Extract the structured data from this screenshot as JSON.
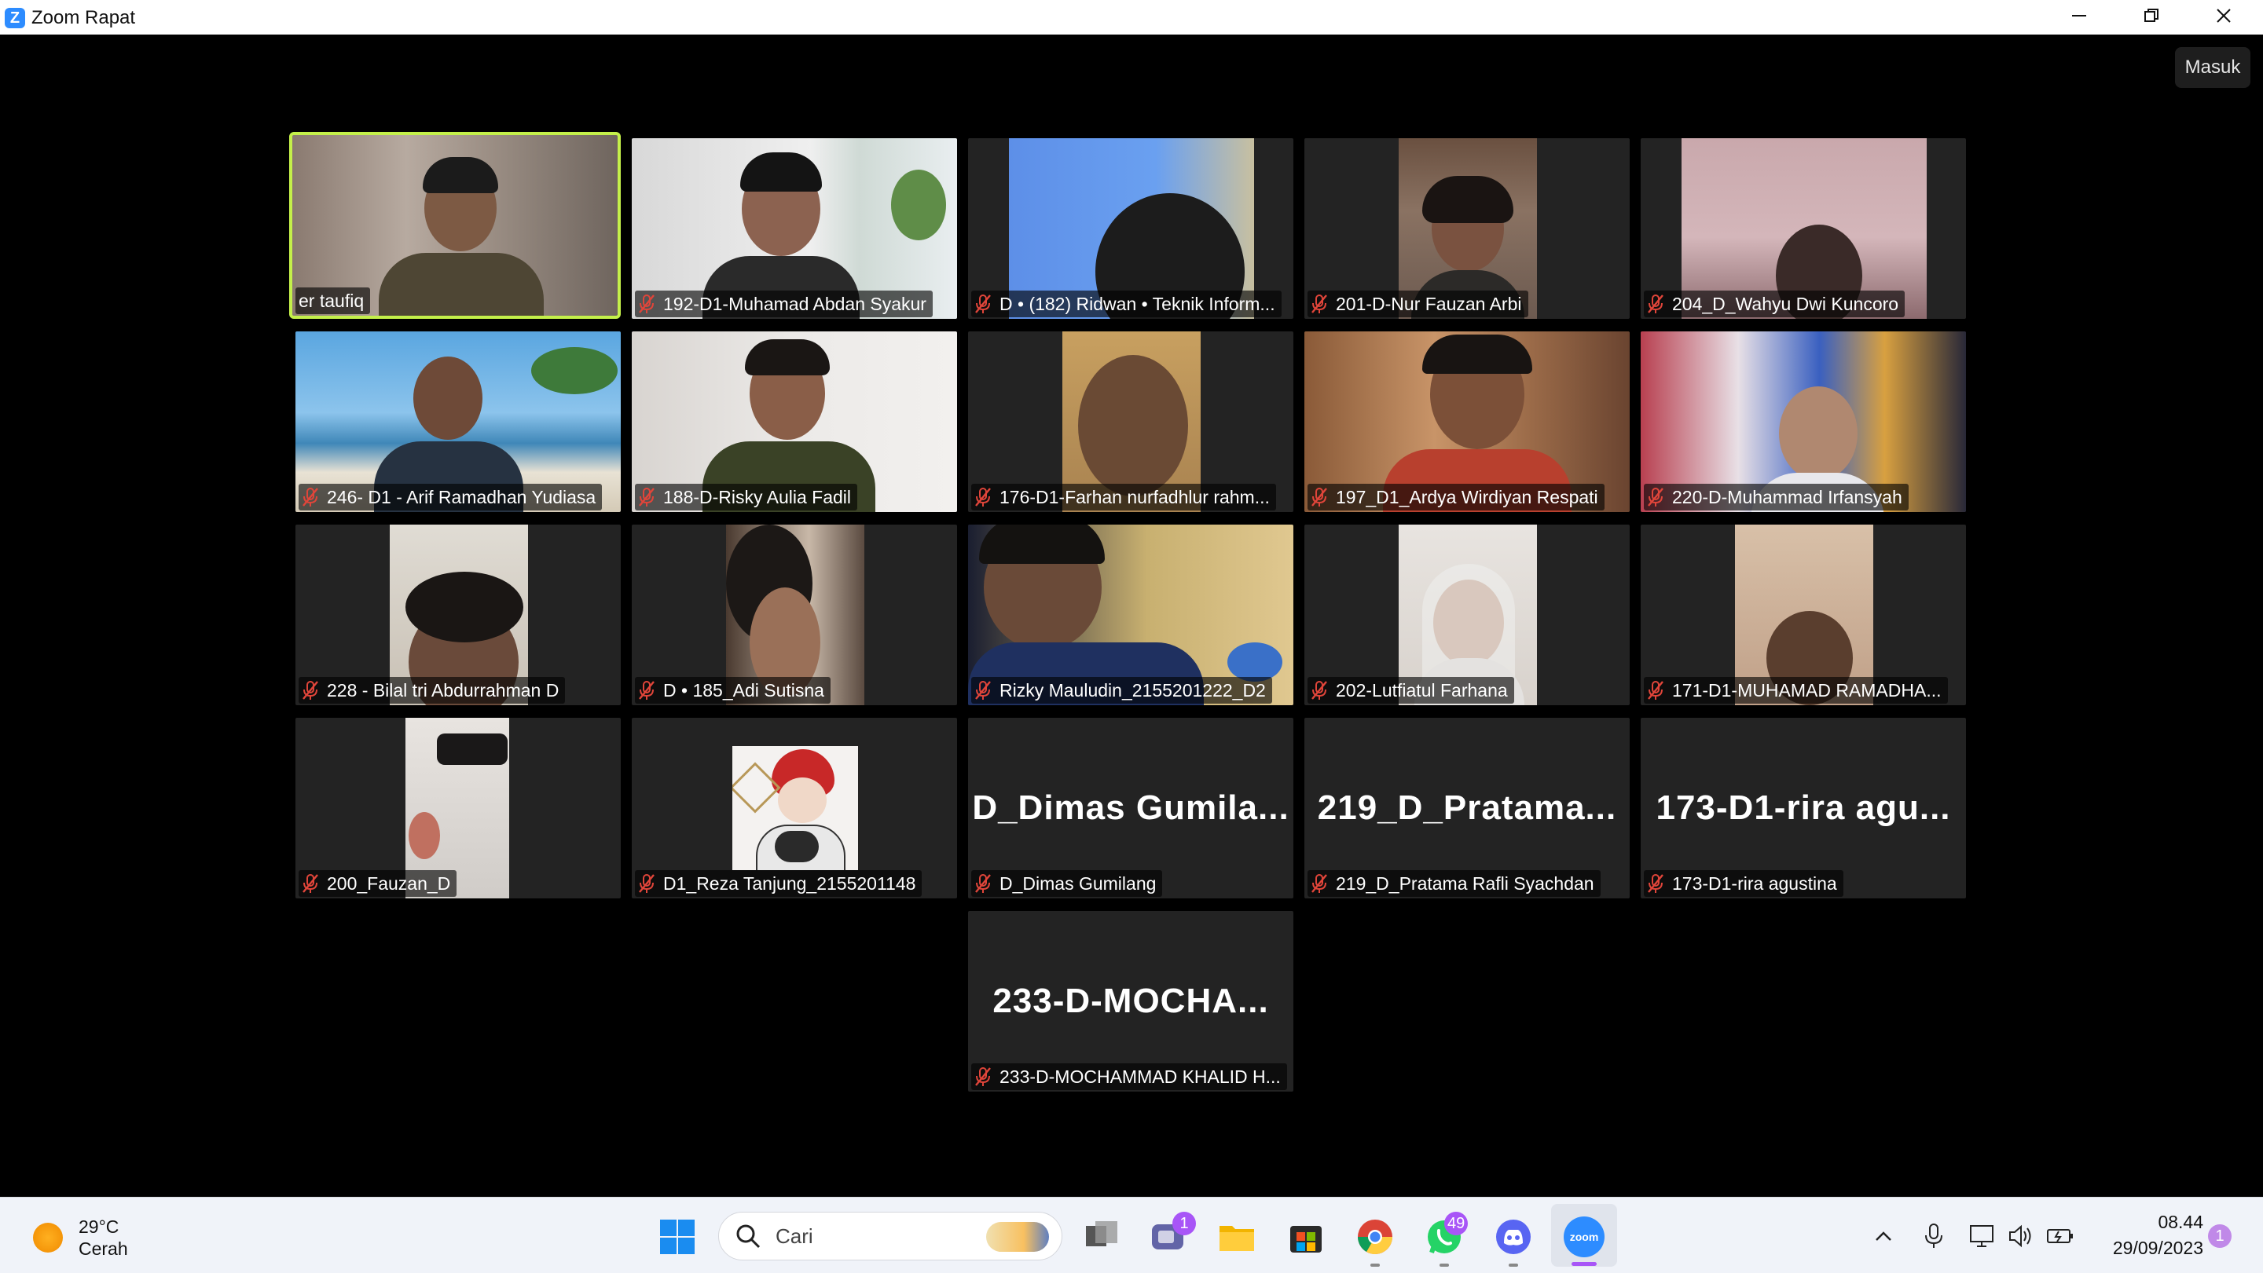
{
  "window": {
    "title": "Zoom Rapat",
    "logo_letter": "Z",
    "sign_in_label": "Masuk"
  },
  "participants": [
    {
      "label": "er taufiq",
      "muted": false,
      "active": true
    },
    {
      "label": "192-D1-Muhamad Abdan Syakur",
      "muted": true
    },
    {
      "label": "D • (182) Ridwan • Teknik Inform...",
      "muted": true
    },
    {
      "label": "201-D-Nur Fauzan Arbi",
      "muted": true
    },
    {
      "label": "204_D_Wahyu Dwi Kuncoro",
      "muted": true
    },
    {
      "label": "246- D1 - Arif Ramadhan Yudiasa",
      "muted": true
    },
    {
      "label": "188-D-Risky Aulia Fadil",
      "muted": true
    },
    {
      "label": "176-D1-Farhan nurfadhlur rahm...",
      "muted": true
    },
    {
      "label": "197_D1_Ardya Wirdiyan Respati",
      "muted": true
    },
    {
      "label": "220-D-Muhammad Irfansyah",
      "muted": true
    },
    {
      "label": "228 - Bilal tri Abdurrahman D",
      "muted": true
    },
    {
      "label": "D • 185_Adi Sutisna",
      "muted": true
    },
    {
      "label": "Rizky Mauludin_2155201222_D2",
      "muted": true
    },
    {
      "label": "202-Lutfiatul Farhana",
      "muted": true
    },
    {
      "label": "171-D1-MUHAMAD RAMADHA...",
      "muted": true
    },
    {
      "label": "200_Fauzan_D",
      "muted": true
    },
    {
      "label": "D1_Reza Tanjung_2155201148",
      "muted": true
    },
    {
      "label": "D_Dimas Gumilang",
      "muted": true,
      "display_name": "D_Dimas  Gumila..."
    },
    {
      "label": "219_D_Pratama Rafli Syachdan",
      "muted": true,
      "display_name": "219_D_Pratama..."
    },
    {
      "label": "173-D1-rira agustina",
      "muted": true,
      "display_name": "173-D1-rira  agu..."
    },
    {
      "label": "233-D-MOCHAMMAD KHALID H...",
      "muted": true,
      "display_name": "233-D-MOCHA..."
    }
  ],
  "taskbar": {
    "weather_temp": "29°C",
    "weather_desc": "Cerah",
    "search_placeholder": "Cari",
    "teams_badge": "1",
    "whatsapp_badge": "49",
    "zoom_icon_text": "zoom",
    "time": "08.44",
    "date": "29/09/2023",
    "notification_count": "1"
  },
  "colors": {
    "active_speaker_border": "#c4f04a",
    "muted_mic": "#e0453a",
    "zoom_blue": "#2d8cff"
  }
}
